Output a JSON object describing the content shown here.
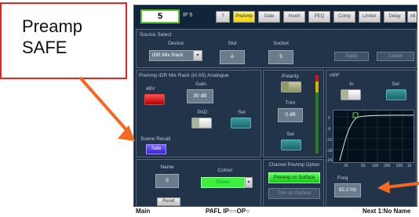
{
  "callout": {
    "line1": "Preamp",
    "line2": "SAFE"
  },
  "header": {
    "channel_number": "5",
    "channel_name": "IP 5",
    "help_label": "?",
    "tabs": [
      "PreAmp",
      "Gate",
      "Insert",
      "PEQ",
      "Comp",
      "Limiter",
      "Delay",
      "All"
    ],
    "active_tab": "PreAmp"
  },
  "source_select": {
    "title": "Source Select",
    "device_label": "Device",
    "device_value": "iDR Mix Rack",
    "slot_label": "Slot",
    "slot_value": "A",
    "socket_label": "Socket",
    "socket_value": "5",
    "apply_label": "Apply",
    "cancel_label": "Cancel"
  },
  "preamp": {
    "title": "PreAmp   iDR Mix Rack (I/I A5) Analogue",
    "phantom_label": "48V",
    "gain_label": "Gain",
    "gain_value": "30 dB",
    "pad_label": "PAD",
    "sel_label": "Sel",
    "scene_recall_label": "Scene Recall",
    "safe_label": "Safe"
  },
  "polarity": {
    "polarity_label": "Polarity",
    "trim_label": "Trim",
    "trim_value": "0 dB",
    "sel_label": "Sel"
  },
  "hpf": {
    "title": "HPF",
    "in_label": "In",
    "sel_label": "Sel",
    "y_labels": [
      "0",
      "-6",
      "-12",
      "-18",
      "-24"
    ],
    "x_labels": [
      "20",
      "50",
      "100",
      "200",
      "500",
      "1k"
    ],
    "freq_label": "Freq",
    "freq_value": "92.2 Hz"
  },
  "name_colour": {
    "name_label": "Name",
    "name_value": "5",
    "colour_label": "Colour",
    "colour_value": "Green",
    "reset_label": "Reset"
  },
  "channel_preamp_option": {
    "title": "Channel PreAmp Option",
    "preamp_on_surface": "PreAmp on Surface",
    "trim_on_surface": "Trim on Surface"
  },
  "status_bar": {
    "left": "Main",
    "center": "PAFL IP○○OP○",
    "right": "Next 1:No Name"
  },
  "colors": {
    "callout_border": "#e52521",
    "arrow": "#f26a21",
    "active_tab": "#f4d000",
    "safe_button": "#4a30e6",
    "green_button": "#2edc2e"
  }
}
